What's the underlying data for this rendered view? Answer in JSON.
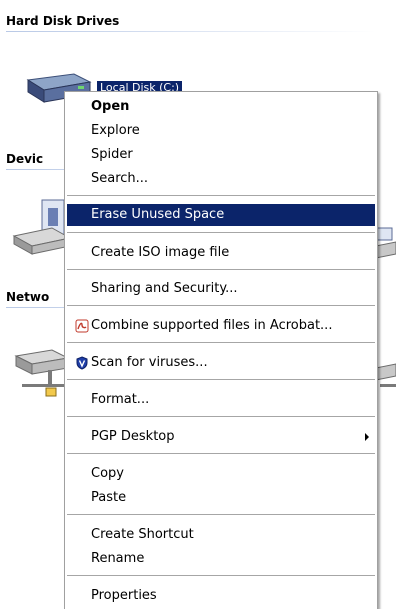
{
  "sections": {
    "hard_disk": "Hard Disk Drives",
    "devices": "Devic",
    "network": "Netwo"
  },
  "drive": {
    "label": "Local Disk (C:)"
  },
  "menu": {
    "open": "Open",
    "explore": "Explore",
    "spider": "Spider",
    "search": "Search...",
    "erase": "Erase Unused Space",
    "iso": "Create ISO image file",
    "sharing": "Sharing and Security...",
    "combine": "Combine supported files in Acrobat...",
    "scan": "Scan for viruses...",
    "format": "Format...",
    "pgp": "PGP Desktop",
    "copy": "Copy",
    "paste": "Paste",
    "shortcut": "Create Shortcut",
    "rename": "Rename",
    "properties": "Properties"
  },
  "icons": {
    "drive": "hard-drive-icon",
    "acrobat": "acrobat-icon",
    "antivirus": "shield-icon",
    "submenu": "submenu-arrow-icon"
  },
  "colors": {
    "highlight": "#0b246a",
    "section_rule": "#b9c9e6"
  }
}
